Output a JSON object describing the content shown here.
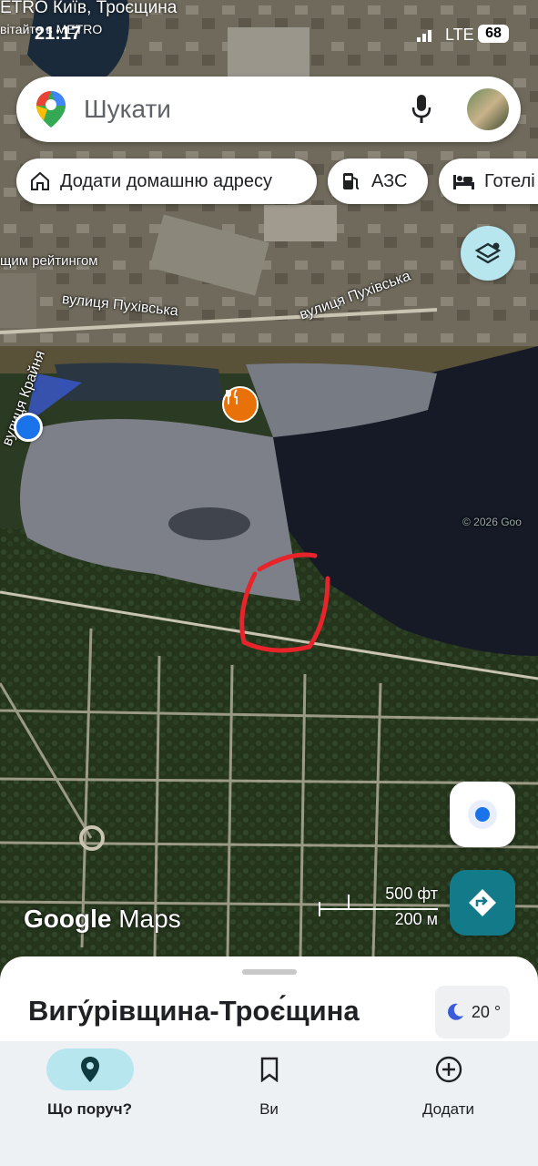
{
  "status_bar": {
    "overlay_title": "ETRO Київ, Троєщина",
    "overlay_subtitle": "вітайте в METRO",
    "time": "21:17",
    "network": "LTE",
    "battery": "68"
  },
  "search": {
    "placeholder": "Шукати",
    "icons": [
      "maps-pin-icon",
      "mic-icon",
      "avatar"
    ]
  },
  "chips": [
    {
      "label": "Додати домашню адресу",
      "icon": "home-icon"
    },
    {
      "label": "АЗС",
      "icon": "gas-station-icon"
    },
    {
      "label": "Готелі",
      "icon": "hotel-icon"
    }
  ],
  "map": {
    "labels": {
      "street1": "вулиця Пухівська",
      "street2": "вулиця Пухівська",
      "street3": "вулиця Крайня",
      "rating": "щим рейтингом"
    },
    "copyright": "© 2026 Goo",
    "brand_google": "Google",
    "brand_maps": "Maps",
    "scale_top": "500 фт",
    "scale_bottom": "200 м"
  },
  "sheet": {
    "place_name": "Вигу́рівщина-Троє́щина",
    "weather": "20 °"
  },
  "bottom_nav": [
    {
      "label": "Що поруч?",
      "icon": "location-pin-icon",
      "active": true
    },
    {
      "label": "Ви",
      "icon": "bookmark-icon",
      "active": false
    },
    {
      "label": "Додати",
      "icon": "add-circle-icon",
      "active": false
    }
  ],
  "colors": {
    "accent_teal": "#137a8a",
    "location_blue": "#1a73e8",
    "annotation_red": "#e8232a",
    "restaurant_orange": "#e8710a"
  }
}
